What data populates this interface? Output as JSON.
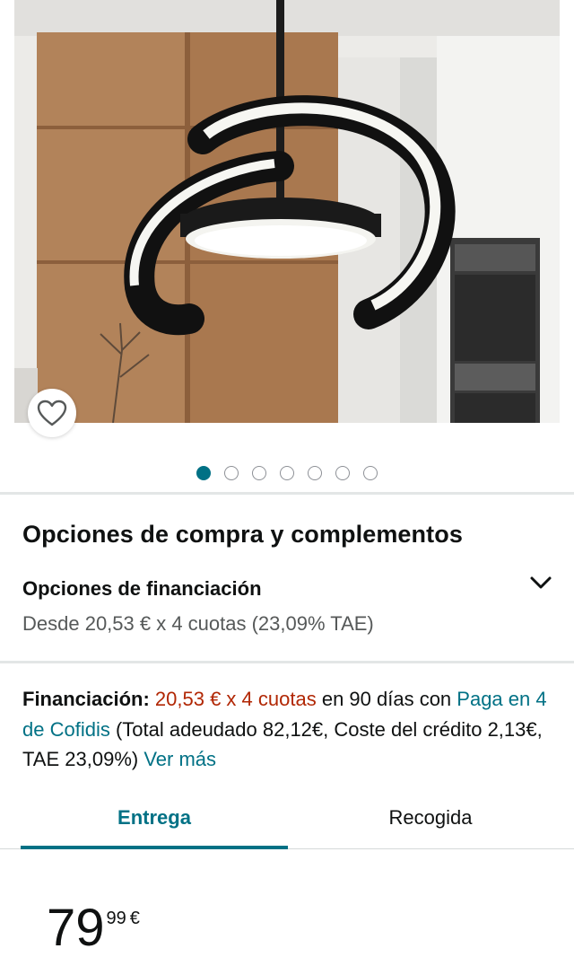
{
  "product_image": {
    "alt_icon": "pendant-lamp-photo",
    "wishlist_icon": "heart-icon"
  },
  "carousel": {
    "count": 7,
    "active_index": 0
  },
  "purchase_options": {
    "title": "Opciones de compra y complementos",
    "financing_title": "Opciones de financiación",
    "financing_subtitle": "Desde 20,53 € x 4 cuotas (23,09% TAE)",
    "expand_icon": "chevron-down-icon"
  },
  "financing": {
    "label": "Financiación:",
    "installments": "20,53 € x 4 cuotas",
    "term": " en 90 días con ",
    "provider": "Paga en 4 de Cofidis",
    "details": " (Total adeudado 82,12€, Coste del crédito 2,13€, TAE 23,09%) ",
    "see_more": "Ver más"
  },
  "tabs": [
    {
      "label": "Entrega",
      "active": true
    },
    {
      "label": "Recogida",
      "active": false
    }
  ],
  "price": {
    "whole": "79",
    "fraction": "99",
    "currency": "€"
  },
  "colors": {
    "accent": "#007185",
    "price_red": "#b12704",
    "text": "#0f1111",
    "muted": "#565959"
  }
}
